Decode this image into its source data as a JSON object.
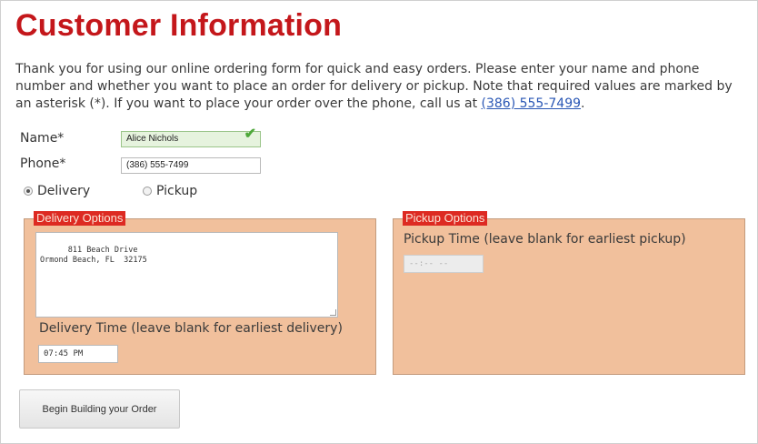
{
  "page": {
    "title": "Customer Information",
    "intro_text": "Thank you for using our online ordering form for quick and easy orders. Please enter your name and phone number and whether you want to place an order for delivery or pickup. Note that required values are marked by an asterisk (*). If you want to place your order over the phone, call us at",
    "phone_link": "(386) 555-7499",
    "intro_end": "."
  },
  "form": {
    "name_label": "Name*",
    "name_value": "Alice Nichols",
    "phone_label": "Phone*",
    "phone_value": "(386) 555-7499",
    "delivery_label": "Delivery",
    "pickup_label": "Pickup",
    "selected_option": "Delivery"
  },
  "delivery": {
    "legend": "Delivery Options",
    "address_value": "811 Beach Drive\nOrmond Beach, FL  32175",
    "time_label": "Delivery Time (leave blank for earliest delivery)",
    "time_value": "07:45 PM"
  },
  "pickup": {
    "legend": "Pickup Options",
    "time_label": "Pickup Time (leave blank for earliest pickup)",
    "time_value": "--:-- --"
  },
  "actions": {
    "begin_order_label": "Begin Building your Order"
  },
  "colors": {
    "title": "#c4171b",
    "panel_bg": "#f1c09c",
    "legend_bg": "#dd2a22",
    "link": "#2a57b5",
    "valid_field": "#e6f3de"
  },
  "icons": {
    "valid": "checkmark-icon"
  }
}
